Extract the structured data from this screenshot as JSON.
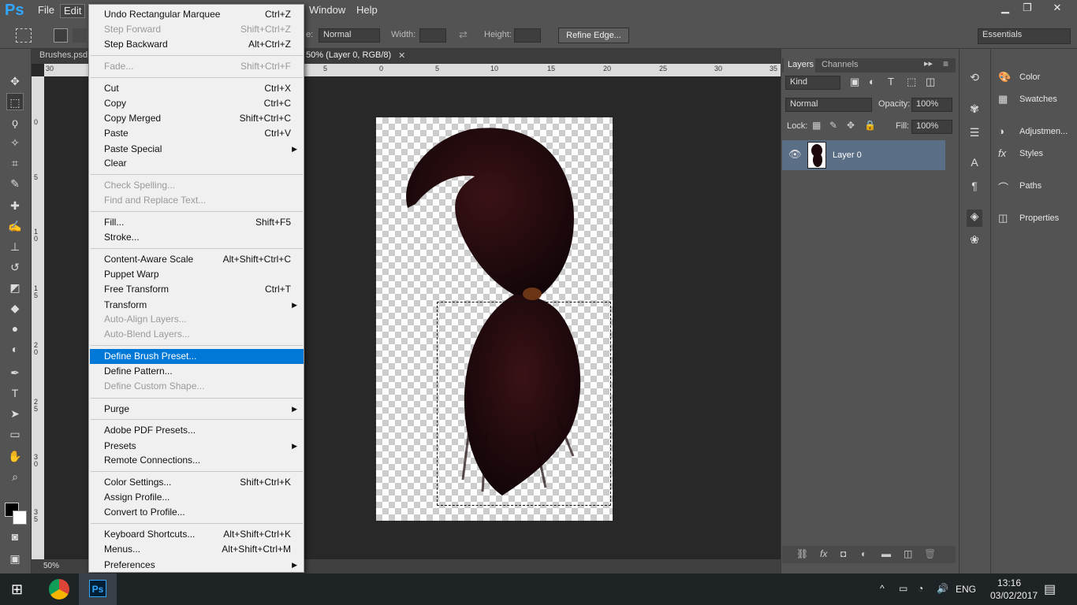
{
  "menubar": {
    "logo": "Ps",
    "items": [
      "File",
      "Edit",
      "Window",
      "Help"
    ],
    "window_controls": [
      "▁",
      "❐",
      "✕"
    ]
  },
  "options": {
    "style_label": "e:",
    "style_value": "Normal",
    "width_label": "Width:",
    "height_label": "Height:",
    "refine_edge": "Refine Edge...",
    "workspace": "Essentials"
  },
  "tabs": {
    "brushes": "Brushes.psd",
    "active_suffix": "50% (Layer 0, RGB/8)",
    "close": "✕"
  },
  "ruler": {
    "h_ticks": [
      "30",
      "5",
      "0",
      "5",
      "10",
      "15",
      "20",
      "25",
      "30",
      "35"
    ],
    "v_ticks": [
      "0",
      "5",
      "1 0",
      "1 5",
      "2 0",
      "2 5",
      "3 0",
      "3 5"
    ]
  },
  "status": {
    "zoom": "50%"
  },
  "edit_menu": {
    "items": [
      {
        "label": "Undo Rectangular Marquee",
        "shortcut": "Ctrl+Z",
        "disabled": false
      },
      {
        "label": "Step Forward",
        "shortcut": "Shift+Ctrl+Z",
        "disabled": true
      },
      {
        "label": "Step Backward",
        "shortcut": "Alt+Ctrl+Z",
        "disabled": false
      },
      {
        "label": "Fade...",
        "shortcut": "Shift+Ctrl+F",
        "disabled": true
      },
      {
        "label": "Cut",
        "shortcut": "Ctrl+X",
        "disabled": false
      },
      {
        "label": "Copy",
        "shortcut": "Ctrl+C",
        "disabled": false
      },
      {
        "label": "Copy Merged",
        "shortcut": "Shift+Ctrl+C",
        "disabled": false
      },
      {
        "label": "Paste",
        "shortcut": "Ctrl+V",
        "disabled": false
      },
      {
        "label": "Paste Special",
        "shortcut": "",
        "disabled": false,
        "submenu": true
      },
      {
        "label": "Clear",
        "shortcut": "",
        "disabled": false
      },
      {
        "label": "Check Spelling...",
        "shortcut": "",
        "disabled": true
      },
      {
        "label": "Find and Replace Text...",
        "shortcut": "",
        "disabled": true
      },
      {
        "label": "Fill...",
        "shortcut": "Shift+F5",
        "disabled": false
      },
      {
        "label": "Stroke...",
        "shortcut": "",
        "disabled": false
      },
      {
        "label": "Content-Aware Scale",
        "shortcut": "Alt+Shift+Ctrl+C",
        "disabled": false
      },
      {
        "label": "Puppet Warp",
        "shortcut": "",
        "disabled": false
      },
      {
        "label": "Free Transform",
        "shortcut": "Ctrl+T",
        "disabled": false
      },
      {
        "label": "Transform",
        "shortcut": "",
        "disabled": false,
        "submenu": true
      },
      {
        "label": "Auto-Align Layers...",
        "shortcut": "",
        "disabled": true
      },
      {
        "label": "Auto-Blend Layers...",
        "shortcut": "",
        "disabled": true
      },
      {
        "label": "Define Brush Preset...",
        "shortcut": "",
        "disabled": false,
        "highlighted": true
      },
      {
        "label": "Define Pattern...",
        "shortcut": "",
        "disabled": false
      },
      {
        "label": "Define Custom Shape...",
        "shortcut": "",
        "disabled": true
      },
      {
        "label": "Purge",
        "shortcut": "",
        "disabled": false,
        "submenu": true
      },
      {
        "label": "Adobe PDF Presets...",
        "shortcut": "",
        "disabled": false
      },
      {
        "label": "Presets",
        "shortcut": "",
        "disabled": false,
        "submenu": true
      },
      {
        "label": "Remote Connections...",
        "shortcut": "",
        "disabled": false
      },
      {
        "label": "Color Settings...",
        "shortcut": "Shift+Ctrl+K",
        "disabled": false
      },
      {
        "label": "Assign Profile...",
        "shortcut": "",
        "disabled": false
      },
      {
        "label": "Convert to Profile...",
        "shortcut": "",
        "disabled": false
      },
      {
        "label": "Keyboard Shortcuts...",
        "shortcut": "Alt+Shift+Ctrl+K",
        "disabled": false
      },
      {
        "label": "Menus...",
        "shortcut": "Alt+Shift+Ctrl+M",
        "disabled": false
      },
      {
        "label": "Preferences",
        "shortcut": "",
        "disabled": false,
        "submenu": true
      }
    ]
  },
  "layers": {
    "tabs": [
      "Layers",
      "Channels"
    ],
    "filter": "Kind",
    "blend": "Normal",
    "opacity_label": "Opacity:",
    "opacity": "100%",
    "lock_label": "Lock:",
    "fill_label": "Fill:",
    "fill": "100%",
    "layer_name": "Layer 0"
  },
  "right_panel": {
    "items": [
      "Color",
      "Swatches",
      "Adjustmen...",
      "Styles",
      "Paths",
      "Properties"
    ]
  },
  "taskbar": {
    "lang": "ENG",
    "time": "13:16",
    "date": "03/02/2017"
  },
  "colors": {
    "highlight": "#0078d7",
    "ps_blue": "#31a8ff",
    "layer_selected": "#5a6e86"
  }
}
